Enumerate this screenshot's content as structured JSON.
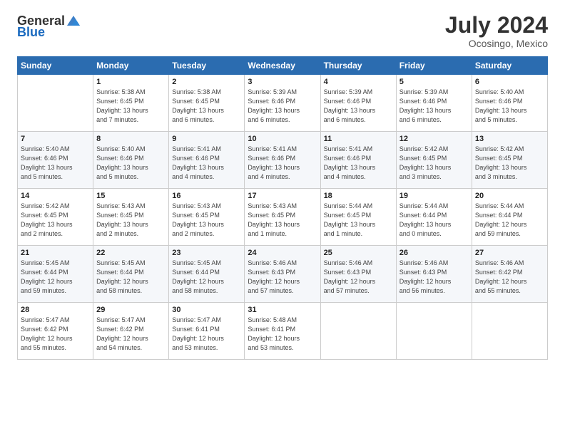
{
  "header": {
    "logo_general": "General",
    "logo_blue": "Blue",
    "month_year": "July 2024",
    "location": "Ocosingo, Mexico"
  },
  "days_of_week": [
    "Sunday",
    "Monday",
    "Tuesday",
    "Wednesday",
    "Thursday",
    "Friday",
    "Saturday"
  ],
  "weeks": [
    [
      {
        "day": "",
        "info": ""
      },
      {
        "day": "1",
        "info": "Sunrise: 5:38 AM\nSunset: 6:45 PM\nDaylight: 13 hours\nand 7 minutes."
      },
      {
        "day": "2",
        "info": "Sunrise: 5:38 AM\nSunset: 6:45 PM\nDaylight: 13 hours\nand 6 minutes."
      },
      {
        "day": "3",
        "info": "Sunrise: 5:39 AM\nSunset: 6:46 PM\nDaylight: 13 hours\nand 6 minutes."
      },
      {
        "day": "4",
        "info": "Sunrise: 5:39 AM\nSunset: 6:46 PM\nDaylight: 13 hours\nand 6 minutes."
      },
      {
        "day": "5",
        "info": "Sunrise: 5:39 AM\nSunset: 6:46 PM\nDaylight: 13 hours\nand 6 minutes."
      },
      {
        "day": "6",
        "info": "Sunrise: 5:40 AM\nSunset: 6:46 PM\nDaylight: 13 hours\nand 5 minutes."
      }
    ],
    [
      {
        "day": "7",
        "info": "Sunrise: 5:40 AM\nSunset: 6:46 PM\nDaylight: 13 hours\nand 5 minutes."
      },
      {
        "day": "8",
        "info": "Sunrise: 5:40 AM\nSunset: 6:46 PM\nDaylight: 13 hours\nand 5 minutes."
      },
      {
        "day": "9",
        "info": "Sunrise: 5:41 AM\nSunset: 6:46 PM\nDaylight: 13 hours\nand 4 minutes."
      },
      {
        "day": "10",
        "info": "Sunrise: 5:41 AM\nSunset: 6:46 PM\nDaylight: 13 hours\nand 4 minutes."
      },
      {
        "day": "11",
        "info": "Sunrise: 5:41 AM\nSunset: 6:46 PM\nDaylight: 13 hours\nand 4 minutes."
      },
      {
        "day": "12",
        "info": "Sunrise: 5:42 AM\nSunset: 6:45 PM\nDaylight: 13 hours\nand 3 minutes."
      },
      {
        "day": "13",
        "info": "Sunrise: 5:42 AM\nSunset: 6:45 PM\nDaylight: 13 hours\nand 3 minutes."
      }
    ],
    [
      {
        "day": "14",
        "info": "Sunrise: 5:42 AM\nSunset: 6:45 PM\nDaylight: 13 hours\nand 2 minutes."
      },
      {
        "day": "15",
        "info": "Sunrise: 5:43 AM\nSunset: 6:45 PM\nDaylight: 13 hours\nand 2 minutes."
      },
      {
        "day": "16",
        "info": "Sunrise: 5:43 AM\nSunset: 6:45 PM\nDaylight: 13 hours\nand 2 minutes."
      },
      {
        "day": "17",
        "info": "Sunrise: 5:43 AM\nSunset: 6:45 PM\nDaylight: 13 hours\nand 1 minute."
      },
      {
        "day": "18",
        "info": "Sunrise: 5:44 AM\nSunset: 6:45 PM\nDaylight: 13 hours\nand 1 minute."
      },
      {
        "day": "19",
        "info": "Sunrise: 5:44 AM\nSunset: 6:44 PM\nDaylight: 13 hours\nand 0 minutes."
      },
      {
        "day": "20",
        "info": "Sunrise: 5:44 AM\nSunset: 6:44 PM\nDaylight: 12 hours\nand 59 minutes."
      }
    ],
    [
      {
        "day": "21",
        "info": "Sunrise: 5:45 AM\nSunset: 6:44 PM\nDaylight: 12 hours\nand 59 minutes."
      },
      {
        "day": "22",
        "info": "Sunrise: 5:45 AM\nSunset: 6:44 PM\nDaylight: 12 hours\nand 58 minutes."
      },
      {
        "day": "23",
        "info": "Sunrise: 5:45 AM\nSunset: 6:44 PM\nDaylight: 12 hours\nand 58 minutes."
      },
      {
        "day": "24",
        "info": "Sunrise: 5:46 AM\nSunset: 6:43 PM\nDaylight: 12 hours\nand 57 minutes."
      },
      {
        "day": "25",
        "info": "Sunrise: 5:46 AM\nSunset: 6:43 PM\nDaylight: 12 hours\nand 57 minutes."
      },
      {
        "day": "26",
        "info": "Sunrise: 5:46 AM\nSunset: 6:43 PM\nDaylight: 12 hours\nand 56 minutes."
      },
      {
        "day": "27",
        "info": "Sunrise: 5:46 AM\nSunset: 6:42 PM\nDaylight: 12 hours\nand 55 minutes."
      }
    ],
    [
      {
        "day": "28",
        "info": "Sunrise: 5:47 AM\nSunset: 6:42 PM\nDaylight: 12 hours\nand 55 minutes."
      },
      {
        "day": "29",
        "info": "Sunrise: 5:47 AM\nSunset: 6:42 PM\nDaylight: 12 hours\nand 54 minutes."
      },
      {
        "day": "30",
        "info": "Sunrise: 5:47 AM\nSunset: 6:41 PM\nDaylight: 12 hours\nand 53 minutes."
      },
      {
        "day": "31",
        "info": "Sunrise: 5:48 AM\nSunset: 6:41 PM\nDaylight: 12 hours\nand 53 minutes."
      },
      {
        "day": "",
        "info": ""
      },
      {
        "day": "",
        "info": ""
      },
      {
        "day": "",
        "info": ""
      }
    ]
  ]
}
